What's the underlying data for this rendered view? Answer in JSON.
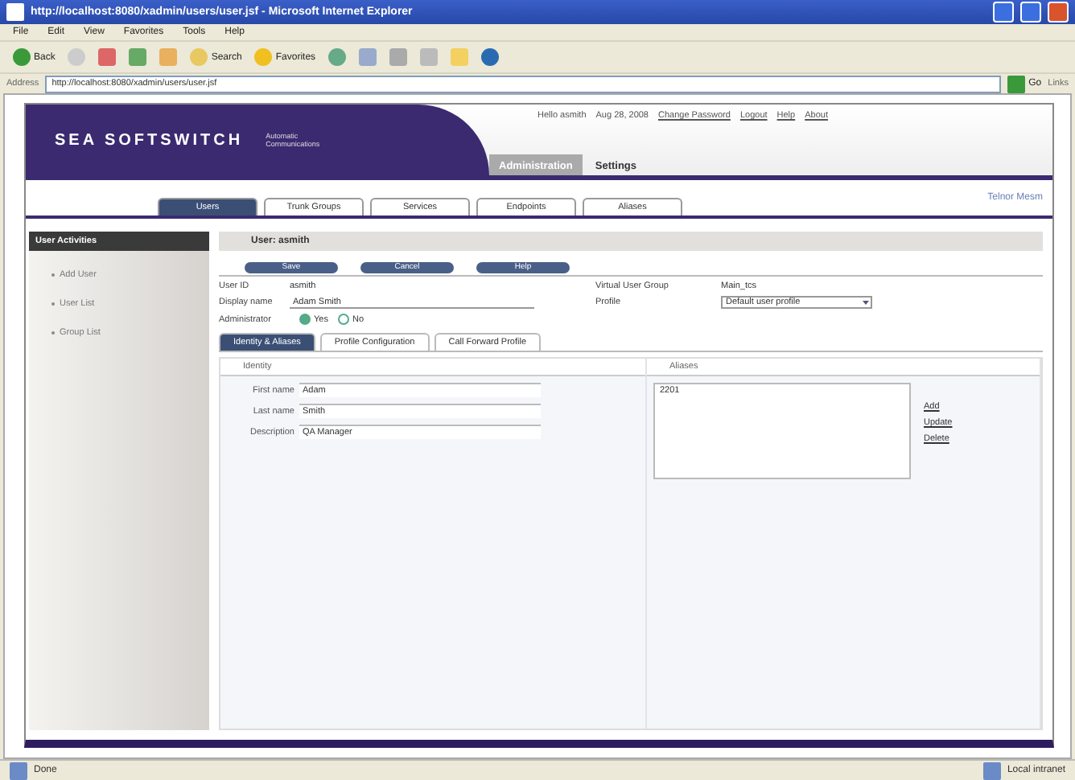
{
  "window": {
    "title": "http://localhost:8080/xadmin/users/user.jsf - Microsoft Internet Explorer"
  },
  "menu": [
    "File",
    "Edit",
    "View",
    "Favorites",
    "Tools",
    "Help"
  ],
  "toolbar": {
    "back": "Back",
    "search": "Search",
    "favorites": "Favorites"
  },
  "address": {
    "label": "Address",
    "value": "http://localhost:8080/xadmin/users/user.jsf",
    "go": "Go",
    "links": "Links"
  },
  "header": {
    "logo": "SEA SOFTSWITCH",
    "tagline": "Automatic Communications",
    "user": "Hello asmith",
    "date": "Aug 28, 2008",
    "links": [
      "Change Password",
      "Logout",
      "Help",
      "About"
    ],
    "brand": "Telnor Mesm"
  },
  "main_tabs": [
    {
      "label": "Administration",
      "selected": true
    },
    {
      "label": "Settings",
      "selected": false
    }
  ],
  "sub_tabs": [
    {
      "label": "Users",
      "selected": true
    },
    {
      "label": "Trunk Groups",
      "selected": false
    },
    {
      "label": "Services",
      "selected": false
    },
    {
      "label": "Endpoints",
      "selected": false
    },
    {
      "label": "Aliases",
      "selected": false
    }
  ],
  "sidebar": {
    "title": "User Activities",
    "items": [
      "Add User",
      "User List",
      "Group List"
    ]
  },
  "form": {
    "title": "User: asmith",
    "buttons": [
      "Save",
      "Cancel",
      "Help"
    ],
    "user_id_label": "User ID",
    "user_id": "asmith",
    "display_name_label": "Display name",
    "display_name": "Adam Smith",
    "group_label": "Virtual User Group",
    "group": "Main_tcs",
    "profile_label": "Profile",
    "profile": "Default user profile",
    "admin_label": "Administrator",
    "admin_options": [
      {
        "label": "Yes",
        "selected": true
      },
      {
        "label": "No",
        "selected": false
      }
    ]
  },
  "detail_tabs": [
    {
      "label": "Identity & Aliases",
      "selected": true
    },
    {
      "label": "Profile Configuration",
      "selected": false
    },
    {
      "label": "Call Forward Profile",
      "selected": false
    }
  ],
  "identity": {
    "title": "Identity",
    "fields": [
      {
        "label": "First name",
        "value": "Adam"
      },
      {
        "label": "Last name",
        "value": "Smith"
      },
      {
        "label": "Description",
        "value": "QA Manager"
      }
    ]
  },
  "aliases": {
    "title": "Aliases",
    "items": [
      "2201"
    ],
    "actions": [
      "Add",
      "Update",
      "Delete"
    ]
  },
  "status_bar": {
    "left": "Done",
    "right": "Local intranet"
  }
}
